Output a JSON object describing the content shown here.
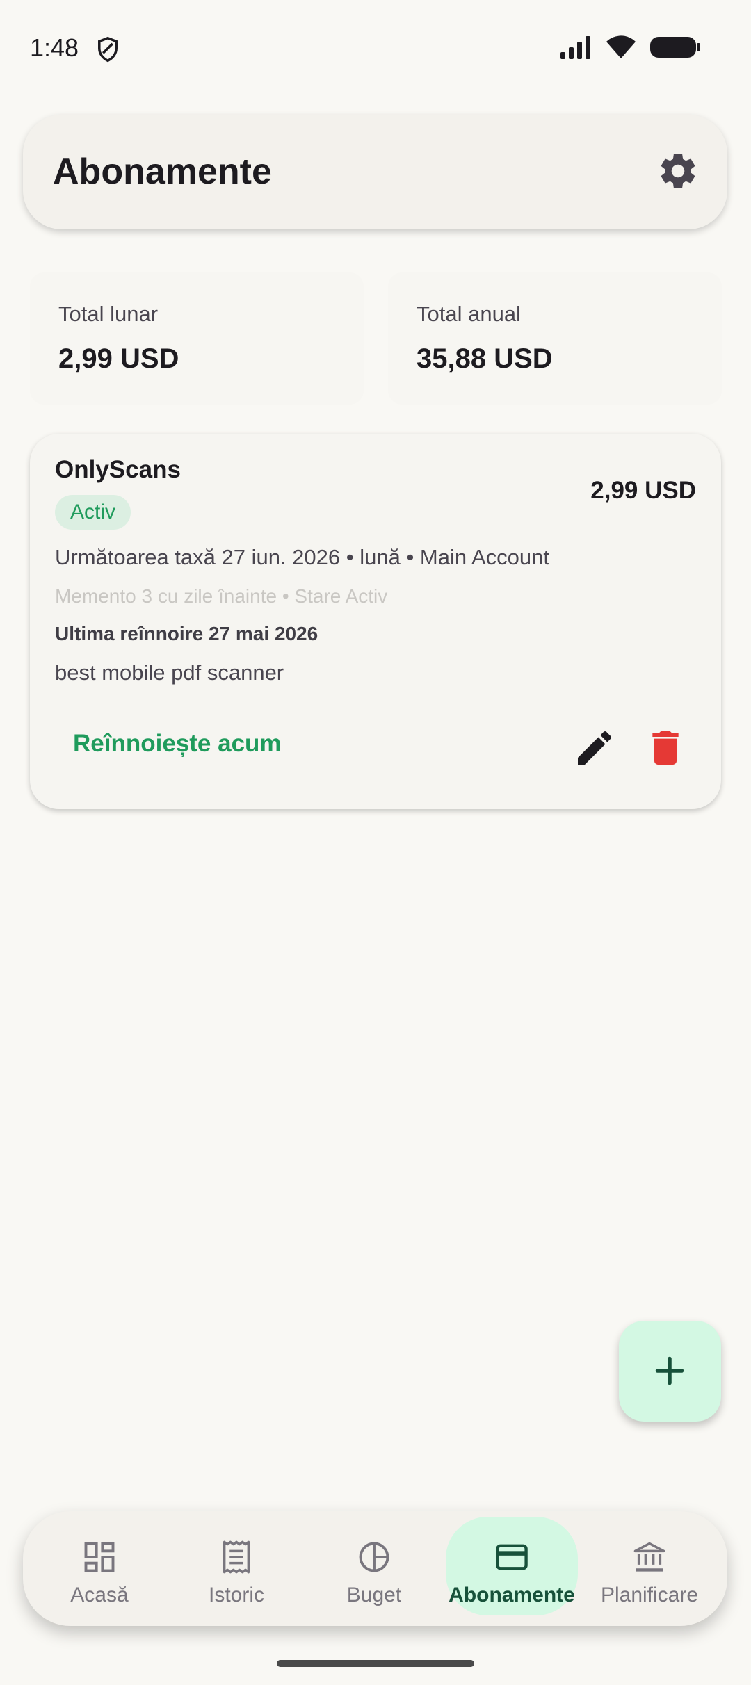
{
  "status_bar": {
    "time": "1:48"
  },
  "app_bar": {
    "title": "Abonamente"
  },
  "totals": {
    "monthly_label": "Total lunar",
    "monthly_value": "2,99 USD",
    "yearly_label": "Total anual",
    "yearly_value": "35,88 USD"
  },
  "subscription": {
    "name": "OnlyScans",
    "status_badge": "Activ",
    "price": "2,99 USD",
    "next_charge": "Următoarea taxă 27 iun. 2026 • lună • Main Account",
    "reminder": "Memento 3 cu zile înainte • Stare Activ",
    "last_renewal": "Ultima reînnoire 27 mai 2026",
    "notes": "best mobile pdf scanner",
    "renew_label": "Reînnoiește acum"
  },
  "bottom_nav": {
    "items": [
      {
        "label": "Acasă",
        "icon": "dashboard-icon"
      },
      {
        "label": "Istoric",
        "icon": "receipt-icon"
      },
      {
        "label": "Buget",
        "icon": "pie-chart-icon"
      },
      {
        "label": "Abonamente",
        "icon": "credit-card-icon",
        "active": true
      },
      {
        "label": "Planificare",
        "icon": "bank-icon"
      }
    ]
  },
  "colors": {
    "accent": "#1f9b5c",
    "accent_container": "#d3f8e3",
    "danger": "#e53935",
    "background": "#f9f8f4"
  }
}
